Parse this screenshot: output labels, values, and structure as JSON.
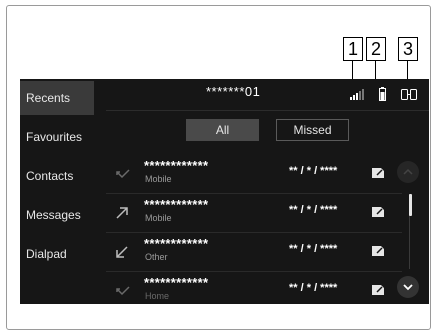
{
  "callouts": [
    "1",
    "2",
    "3"
  ],
  "header": {
    "title": "*******01"
  },
  "sidebar": {
    "items": [
      {
        "label": "Recents",
        "active": true
      },
      {
        "label": "Favourites",
        "active": false
      },
      {
        "label": "Contacts",
        "active": false
      },
      {
        "label": "Messages",
        "active": false
      },
      {
        "label": "Dialpad",
        "active": false
      }
    ]
  },
  "tabs": [
    {
      "label": "All",
      "selected": true
    },
    {
      "label": "Missed",
      "selected": false
    }
  ],
  "calls": [
    {
      "name": "************",
      "type": "Mobile",
      "date": "** / * / ****",
      "icon": "call-incoming-icon"
    },
    {
      "name": "************",
      "type": "Mobile",
      "date": "** / * / ****",
      "icon": "call-outgoing-icon"
    },
    {
      "name": "************",
      "type": "Other",
      "date": "** / * / ****",
      "icon": "call-incoming-icon"
    },
    {
      "name": "************",
      "type": "Home",
      "date": "** / * / ****",
      "icon": "call-incoming-icon"
    }
  ],
  "icons": {
    "signal": "signal-strength-icon",
    "battery": "battery-icon",
    "phone": "phone-connected-icon",
    "row_action": "message-compose-icon",
    "scroll_up": "chevron-up-icon",
    "scroll_down": "chevron-down-icon"
  },
  "colors": {
    "screen_bg": "#161616",
    "active_item_bg": "#3a3a3a",
    "tab_selected_bg": "#4a4a4a"
  }
}
